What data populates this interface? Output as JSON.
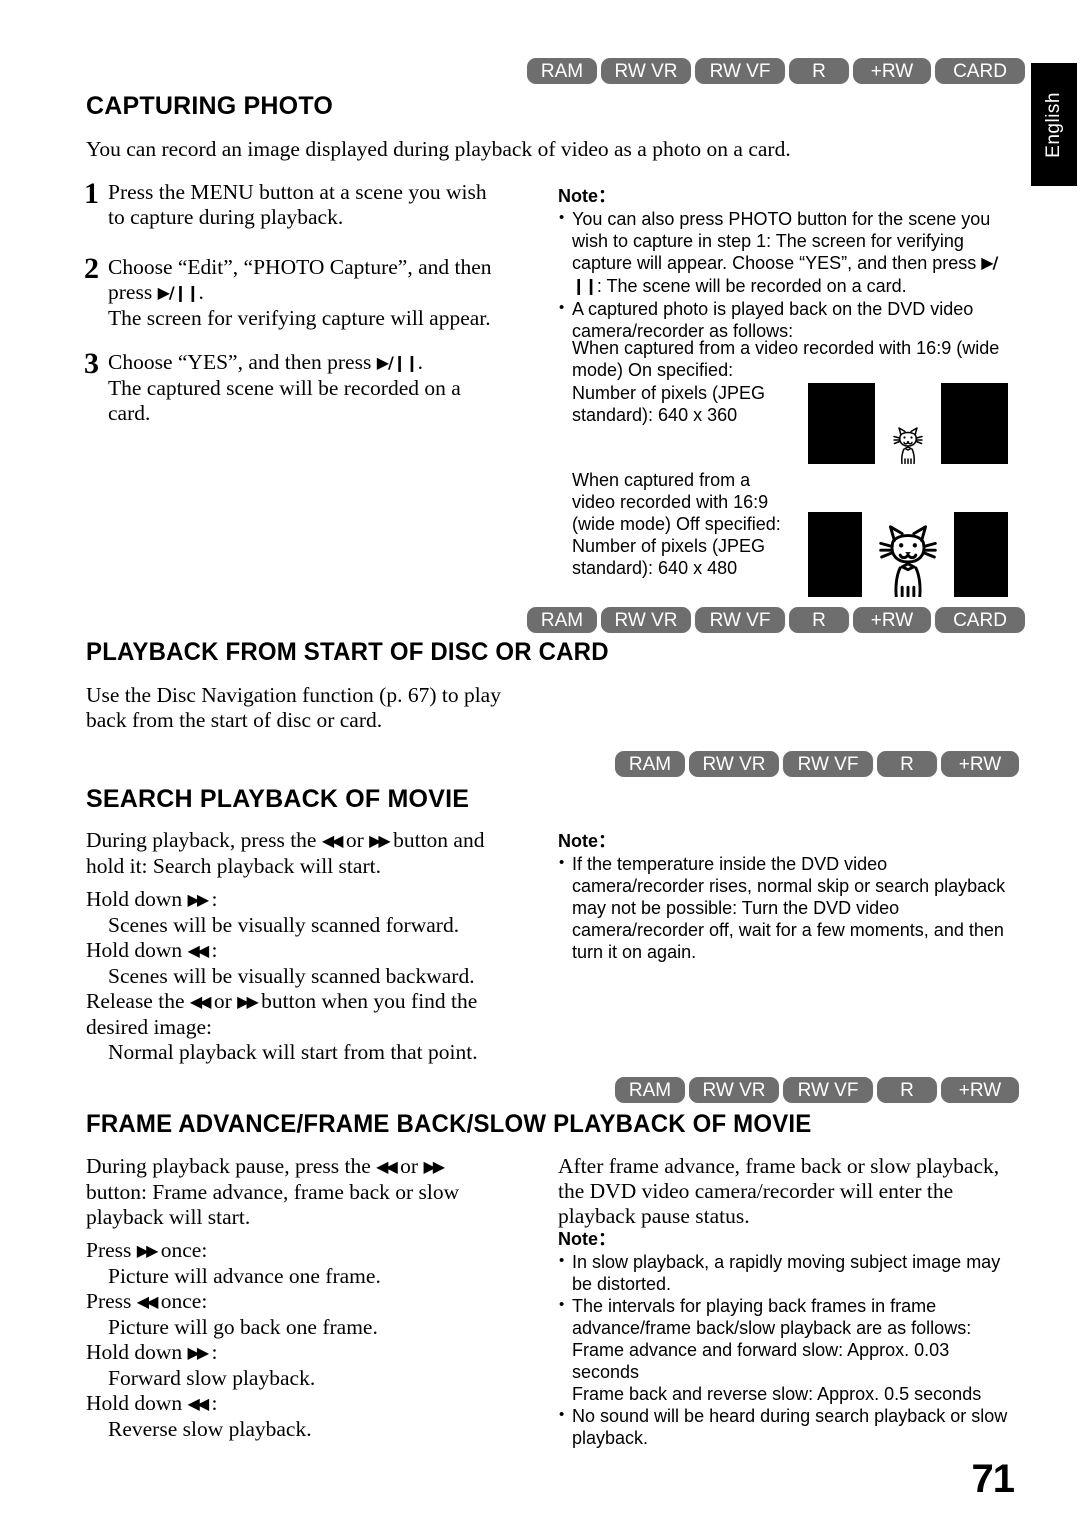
{
  "language_tab": "English",
  "page_number": "71",
  "badge_labels": {
    "ram": "RAM",
    "rw_vr": "RW VR",
    "rw_vf": "RW VF",
    "r": "R",
    "plus_rw": "+RW",
    "card": "CARD"
  },
  "sections": [
    {
      "id": "capturing-photo",
      "title": "CAPTURING PHOTO",
      "badges": [
        "RAM",
        "RW VR",
        "RW VF",
        "R",
        "+RW",
        "CARD"
      ],
      "intro": "You can record an image displayed during playback of video as a photo on a card.",
      "steps": [
        {
          "number": "1",
          "lines": [
            "Press the MENU button at a scene you wish",
            "to capture during playback."
          ]
        },
        {
          "number": "2",
          "line_a": "Choose “Edit”, “PHOTO Capture”, and then",
          "line_b_pre": "press ",
          "line_b_post": ".",
          "line_c": "The screen for verifying capture will appear."
        },
        {
          "number": "3",
          "line_a_pre": "Choose “YES”, and then press ",
          "line_a_post": ".",
          "line_b": "The captured scene will be recorded on a",
          "line_c": "card."
        }
      ],
      "note": {
        "title": "Note：",
        "bullet1_part1": "You can also press PHOTO button for the scene you wish to capture in step 1: The screen for verifying capture will appear. Choose “YES”, and then press",
        "bullet1_part2": ": The scene will be recorded on a card.",
        "bullet2_line1": "A captured photo is played back on the DVD video camera/recorder as follows:",
        "bullet2_line2": "When captured from a video recorded with 16:9 (wide mode) On specified:",
        "bullet2_line3": "Number of pixels (JPEG standard): 640 x 360"
      },
      "caption_off": "When captured from a video recorded with 16:9 (wide mode) Off specified: Number of pixels (JPEG standard): 640 x 480",
      "image_wide_label": "640 x 360 preview",
      "image_tall_label": "640 x 480 preview"
    },
    {
      "id": "playback-from-start",
      "title": "PLAYBACK FROM START OF DISC OR CARD",
      "badges": [
        "RAM",
        "RW VR",
        "RW VF",
        "R",
        "+RW",
        "CARD"
      ],
      "body": "Use the Disc Navigation function (p. 67) to play back from the start of disc or card."
    },
    {
      "id": "search-playback",
      "title": "SEARCH PLAYBACK OF MOVIE",
      "badges": [
        "RAM",
        "RW VR",
        "RW VF",
        "R",
        "+RW"
      ],
      "body": {
        "l1_pre": "During playback, press the ",
        "l1_mid": " or ",
        "l1_post": " button and",
        "l2": "hold it: Search playback will start.",
        "l3_pre": "Hold down ",
        "l3_post": " :",
        "l4": "Scenes will be visually scanned forward.",
        "l5_pre": "Hold down ",
        "l5_post": " :",
        "l6": "Scenes will be visually scanned backward.",
        "l7_pre": "Release the ",
        "l7_mid": " or ",
        "l7_post": " button when you find the",
        "l8": "desired image:",
        "l9": "Normal playback will start from that point."
      },
      "note": {
        "title": "Note：",
        "bullet1": "If the temperature inside the DVD video camera/recorder rises, normal skip or search playback may not be possible: Turn the DVD video camera/recorder off, wait for a few moments, and then turn it on again."
      }
    },
    {
      "id": "frame-advance",
      "title": "FRAME ADVANCE/FRAME BACK/SLOW PLAYBACK OF MOVIE",
      "badges": [
        "RAM",
        "RW VR",
        "RW VF",
        "R",
        "+RW"
      ],
      "left_body": {
        "l1_pre": "During playback pause, press the ",
        "l1_mid": " or ",
        "l1_post": "",
        "l2": "button: Frame advance, frame back or slow",
        "l3": "playback will start.",
        "l4_pre": "Press ",
        "l4_post": " once:",
        "l5": "Picture will advance one frame.",
        "l6_pre": "Press ",
        "l6_post": " once:",
        "l7": "Picture will go back one frame.",
        "l8_pre": "Hold down ",
        "l8_post": " :",
        "l9": "Forward slow playback.",
        "l10_pre": "Hold down ",
        "l10_post": " :",
        "l11": "Reverse slow playback."
      },
      "right_body": "After frame advance, frame back or slow playback, the DVD video camera/recorder will enter the playback pause status.",
      "note": {
        "title": "Note：",
        "bullet1": "In slow playback, a rapidly moving subject image may be distorted.",
        "bullet2_line1": "The intervals for playing back frames in frame advance/frame back/slow playback are as follows:",
        "bullet2_line2": "Frame advance and forward slow: Approx. 0.03 seconds",
        "bullet2_line3": "Frame back and reverse slow: Approx. 0.5 seconds",
        "bullet3": "No sound will be heard during search playback or slow playback."
      }
    }
  ]
}
